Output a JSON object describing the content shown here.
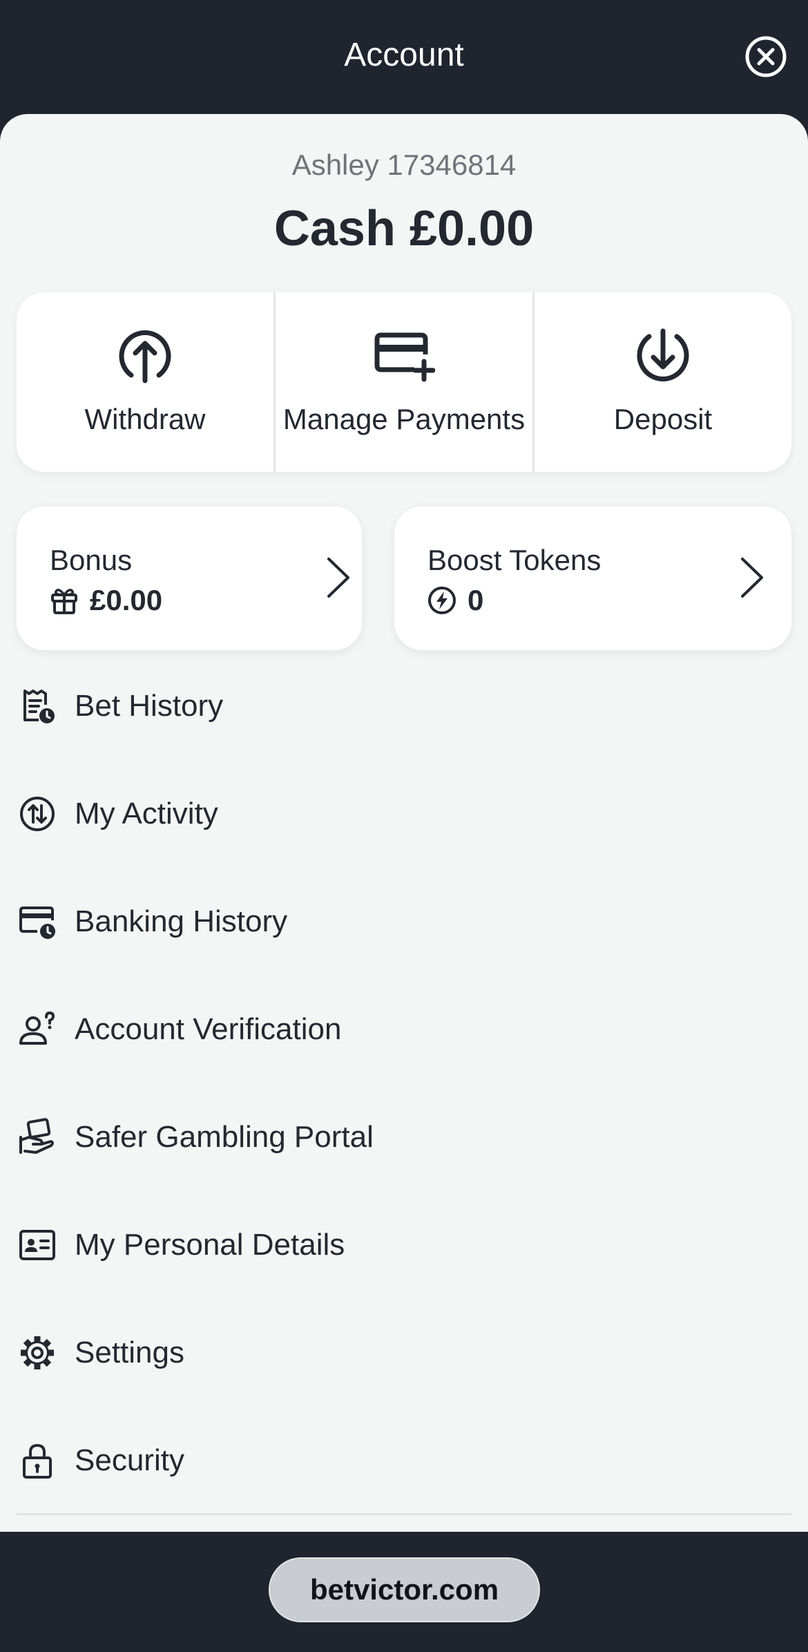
{
  "header": {
    "title": "Account",
    "close_icon": "close-circle-icon"
  },
  "account": {
    "user_line": "Ashley 17346814",
    "cash_line": "Cash £0.00"
  },
  "actions": [
    {
      "label": "Withdraw",
      "icon": "arrow-up-circle-icon"
    },
    {
      "label": "Manage Payments",
      "icon": "card-plus-icon"
    },
    {
      "label": "Deposit",
      "icon": "arrow-down-circle-icon"
    }
  ],
  "bonus": {
    "title": "Bonus",
    "value": "£0.00",
    "icon": "gift-icon"
  },
  "boost": {
    "title": "Boost Tokens",
    "value": "0",
    "icon": "bolt-circle-icon"
  },
  "menu": [
    {
      "label": "Bet History",
      "icon": "receipt-clock-icon"
    },
    {
      "label": "My Activity",
      "icon": "activity-arrows-icon"
    },
    {
      "label": "Banking History",
      "icon": "card-clock-icon"
    },
    {
      "label": "Account Verification",
      "icon": "user-question-icon"
    },
    {
      "label": "Safer Gambling Portal",
      "icon": "hand-card-icon"
    },
    {
      "label": "My Personal Details",
      "icon": "id-card-icon"
    },
    {
      "label": "Settings",
      "icon": "gear-icon"
    },
    {
      "label": "Security",
      "icon": "lock-icon"
    }
  ],
  "footer": {
    "url": "betvictor.com"
  },
  "colors": {
    "dark": "#1f242e",
    "sheet": "#f4f5f5",
    "text": "#232831",
    "muted": "#6f7379"
  }
}
